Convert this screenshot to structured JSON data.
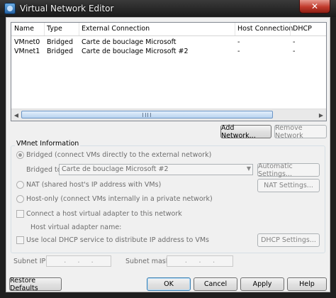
{
  "window": {
    "title": "Virtual Network Editor",
    "close_glyph": "✕"
  },
  "table": {
    "columns": [
      "Name",
      "Type",
      "External Connection",
      "Host Connection",
      "DHCP"
    ],
    "rows": [
      [
        "VMnet0",
        "Bridged",
        "Carte de bouclage Microsoft",
        "-",
        "-"
      ],
      [
        "VMnet1",
        "Bridged",
        "Carte de bouclage Microsoft #2",
        "-",
        "-"
      ]
    ]
  },
  "network_buttons": {
    "add": "Add Network...",
    "remove": "Remove Network"
  },
  "vmnet_info": {
    "group_label": "VMnet Information",
    "bridged_label": "Bridged (connect VMs directly to the external network)",
    "bridged_to_label": "Bridged to:",
    "bridged_to_value": "Carte de bouclage Microsoft #2",
    "automatic_settings": "Automatic Settings...",
    "nat_label": "NAT (shared host's IP address with VMs)",
    "nat_settings": "NAT Settings...",
    "hostonly_label": "Host-only (connect VMs internally in a private network)",
    "connect_adapter_label": "Connect a host virtual adapter to this network",
    "adapter_name_label": "Host virtual adapter name:",
    "dhcp_label": "Use local DHCP service to distribute IP address to VMs",
    "dhcp_settings": "DHCP Settings...",
    "subnet_ip_label": "Subnet IP:",
    "subnet_mask_label": "Subnet mask:",
    "ip_dot": "."
  },
  "footer": {
    "restore": "Restore Defaults",
    "ok": "OK",
    "cancel": "Cancel",
    "apply": "Apply",
    "help": "Help"
  },
  "scroll_glyphs": {
    "left": "◀",
    "right": "▶",
    "combo_arrow": "▼"
  }
}
